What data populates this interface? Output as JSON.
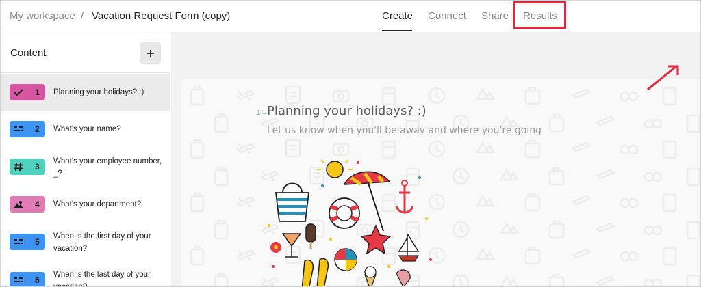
{
  "breadcrumb": {
    "root": "My workspace",
    "separator": "/",
    "form_title": "Vacation Request Form (copy)"
  },
  "tabs": {
    "create": "Create",
    "connect": "Connect",
    "share": "Share",
    "results": "Results",
    "active": "Create",
    "highlighted": "Results"
  },
  "sidebar": {
    "title": "Content",
    "add_symbol": "+",
    "items": [
      {
        "number": "1",
        "label": "Planning your holidays? :)",
        "icon": "checkmark-icon",
        "color": "#d656a2",
        "active": true
      },
      {
        "number": "2",
        "label": "What's your name?",
        "icon": "short-text-icon",
        "color": "#3d94f2",
        "active": false
      },
      {
        "number": "3",
        "label": "What's your employee number, _?",
        "icon": "hash-icon",
        "color": "#4fd1c0",
        "active": false
      },
      {
        "number": "4",
        "label": "What's your department?",
        "icon": "picture-choice-icon",
        "color": "#e07bb6",
        "active": false
      },
      {
        "number": "5",
        "label": "When is the first day of your vacation?",
        "icon": "short-text-icon",
        "color": "#3d94f2",
        "active": false
      },
      {
        "number": "6",
        "label": "When is the last day of your vacation?",
        "icon": "short-text-icon",
        "color": "#3d94f2",
        "active": false
      }
    ]
  },
  "question": {
    "number": "1",
    "arrow": "→",
    "title": "Planning your holidays? :)",
    "description": "Let us know when you'll be away and where you're going",
    "illustration": "beach-holiday-illustration"
  },
  "colors": {
    "highlight": "#e5283b",
    "accent_teal": "#4aa0b5"
  }
}
